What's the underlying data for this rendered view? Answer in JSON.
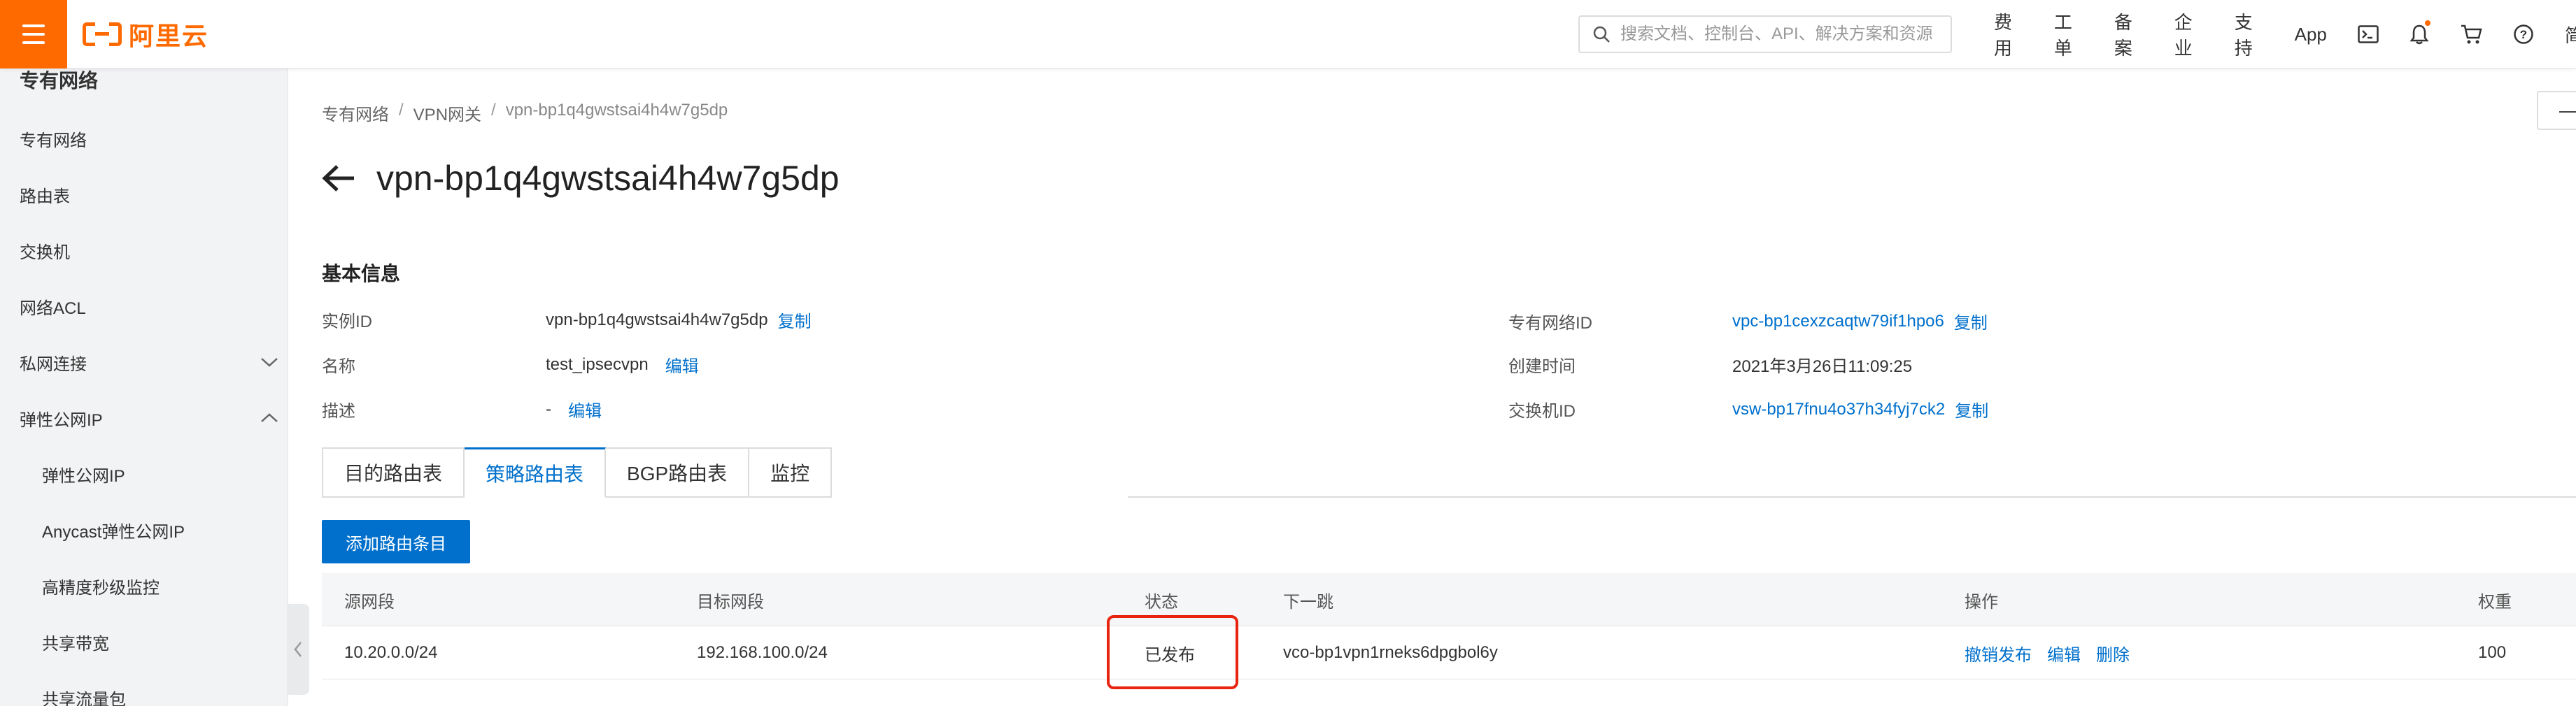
{
  "topbar": {
    "logo_text": "阿里云",
    "search_placeholder": "搜索文档、控制台、API、解决方案和资源",
    "nav": [
      "费用",
      "工单",
      "备案",
      "企业",
      "支持",
      "App"
    ],
    "cut_text": "简",
    "accent": "#ff6a00"
  },
  "sidebar": {
    "title": "专有网络",
    "items": [
      {
        "label": "专有网络"
      },
      {
        "label": "路由表"
      },
      {
        "label": "交换机"
      },
      {
        "label": "网络ACL"
      },
      {
        "label": "私网连接",
        "expand": "chevron-down"
      },
      {
        "label": "弹性公网IP",
        "expand": "chevron-up"
      }
    ],
    "sub_items": [
      {
        "label": "弹性公网IP"
      },
      {
        "label": "Anycast弹性公网IP"
      },
      {
        "label": "高精度秒级监控"
      },
      {
        "label": "共享带宽"
      },
      {
        "label": "共享流量包"
      }
    ]
  },
  "breadcrumb": [
    "专有网络",
    "VPN网关",
    "vpn-bp1q4gwstsai4h4w7g5dp"
  ],
  "right_button": "—",
  "page_title": "vpn-bp1q4gwstsai4h4w7g5dp",
  "basic_info": {
    "title": "基本信息",
    "instance_id_label": "实例ID",
    "instance_id": "vpn-bp1q4gwstsai4h4w7g5dp",
    "copy": "复制",
    "name_label": "名称",
    "name": "test_ipsecvpn",
    "edit": "编辑",
    "desc_label": "描述",
    "desc": "-",
    "vpc_id_label": "专有网络ID",
    "vpc_id": "vpc-bp1cexzcaqtw79if1hpo6",
    "created_label": "创建时间",
    "created": "2021年3月26日11:09:25",
    "vsw_id_label": "交换机ID",
    "vsw_id": "vsw-bp17fnu4o37h34fyj7ck2"
  },
  "tabs": [
    "目的路由表",
    "策略路由表",
    "BGP路由表",
    "监控"
  ],
  "active_tab": "策略路由表",
  "add_button": "添加路由条目",
  "table": {
    "headers": [
      "源网段",
      "目标网段",
      "状态",
      "下一跳",
      "操作",
      "权重"
    ],
    "rows": [
      {
        "source": "10.20.0.0/24",
        "dest": "192.168.100.0/24",
        "status": "已发布",
        "next_hop": "vco-bp1vpn1rneks6dpgbol6y",
        "actions": [
          "撤销发布",
          "编辑",
          "删除"
        ],
        "weight": "100"
      }
    ]
  },
  "colors": {
    "link": "#0070cc",
    "highlight": "#e8230f"
  }
}
